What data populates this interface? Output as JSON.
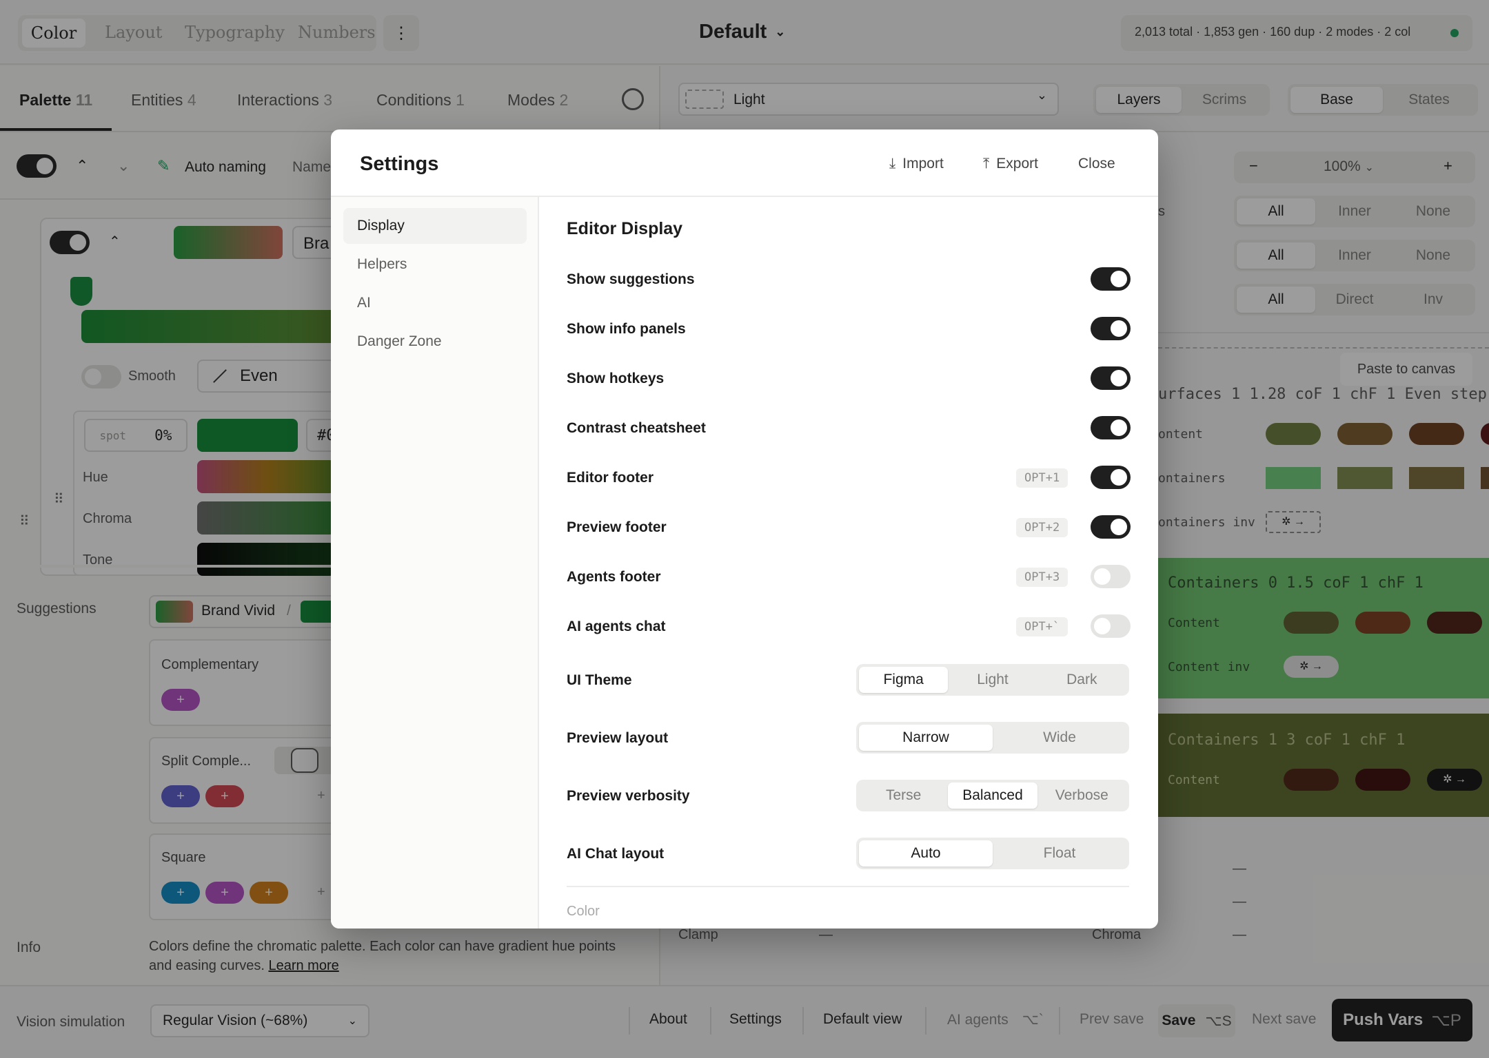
{
  "top_tabs": [
    "Color",
    "Layout",
    "Typography",
    "Numbers"
  ],
  "top_tabs_active": "Color",
  "mode_title": "Default",
  "stats_text": "2,013 total · 1,853 gen · 160 dup · 2 modes · 2 col",
  "stats_status_color": "#1aa05a",
  "left_tabs": [
    {
      "label": "Palette",
      "count": "11"
    },
    {
      "label": "Entities",
      "count": "4"
    },
    {
      "label": "Interactions",
      "count": "3"
    },
    {
      "label": "Conditions",
      "count": "1"
    },
    {
      "label": "Modes",
      "count": "2"
    }
  ],
  "toolbar": {
    "auto_naming": "Auto naming",
    "name_partial": "Name"
  },
  "color_row": {
    "name_partial": "Bra",
    "smooth": "Smooth",
    "easing": "Even",
    "spot_label": "spot",
    "spot_value": "0%",
    "hex_partial": "#0"
  },
  "sliders": [
    "Hue",
    "Chroma",
    "Tone"
  ],
  "suggestions": {
    "label": "Suggestions",
    "brand": "Brand Vivid",
    "separator": "/",
    "groups": [
      "Complementary",
      "Split Comple...",
      "Square"
    ]
  },
  "info": {
    "label": "Info",
    "text": "Colors define the chromatic palette. Each color can have gradient hue points and easing curves.",
    "link": "Learn more"
  },
  "vision": {
    "label": "Vision simulation",
    "value": "Regular Vision (~68%)"
  },
  "preview": {
    "mode_select": "Light",
    "layer_tabs": [
      "Layers",
      "Scrims"
    ],
    "layer_active": "Layers",
    "base_tabs": [
      "Base",
      "States"
    ],
    "base_active": "Base",
    "zoom": "100%",
    "zoom_minus": "−",
    "zoom_plus": "+",
    "filter_rows": [
      [
        "All",
        "Inner",
        "None"
      ],
      [
        "All",
        "Inner",
        "None"
      ],
      [
        "All",
        "Direct",
        "Inv"
      ]
    ],
    "filter_partial": "s",
    "paste": "Paste to canvas",
    "surfaces_header": "urfaces 1  1.28  coF  1  chF  1  Even  step",
    "rows1": [
      "ontent",
      "ontainers",
      "ontainers inv"
    ],
    "containers0_header": "Containers 0  1.5  coF  1  chF  1",
    "rows2": [
      "Content",
      "Content inv"
    ],
    "containers1_header": "Containers 1  3  coF  1  chF  1",
    "rows3": [
      "Content"
    ],
    "swatch_glyph": "✲ →",
    "dash": "—",
    "clamp": "Clamp",
    "chroma": "Chroma"
  },
  "bottom_bar": {
    "about": "About",
    "settings": "Settings",
    "default_view": "Default view",
    "ai_agents": "AI agents",
    "ai_agents_key": "⌥`",
    "prev_save": "Prev save",
    "save": "Save",
    "save_key": "⌥S",
    "next_save": "Next save",
    "push_vars": "Push Vars",
    "push_vars_key": "⌥P"
  },
  "modal": {
    "title": "Settings",
    "import": "Import",
    "export": "Export",
    "close": "Close",
    "nav": [
      "Display",
      "Helpers",
      "AI",
      "Danger Zone"
    ],
    "nav_active": "Display",
    "section_title": "Editor Display",
    "toggles": [
      {
        "label": "Show suggestions",
        "key": "",
        "on": true
      },
      {
        "label": "Show info panels",
        "key": "",
        "on": true
      },
      {
        "label": "Show hotkeys",
        "key": "",
        "on": true
      },
      {
        "label": "Contrast cheatsheet",
        "key": "",
        "on": true
      },
      {
        "label": "Editor footer",
        "key": "OPT+1",
        "on": true
      },
      {
        "label": "Preview footer",
        "key": "OPT+2",
        "on": true
      },
      {
        "label": "Agents footer",
        "key": "OPT+3",
        "on": false
      },
      {
        "label": "AI agents chat",
        "key": "OPT+`",
        "on": false
      }
    ],
    "selects": [
      {
        "label": "UI Theme",
        "options": [
          "Figma",
          "Light",
          "Dark"
        ],
        "selected": "Figma"
      },
      {
        "label": "Preview layout",
        "options": [
          "Narrow",
          "Wide"
        ],
        "selected": "Narrow"
      },
      {
        "label": "Preview verbosity",
        "options": [
          "Terse",
          "Balanced",
          "Verbose"
        ],
        "selected": "Balanced"
      },
      {
        "label": "AI Chat layout",
        "options": [
          "Auto",
          "Float"
        ],
        "selected": "Auto"
      }
    ],
    "next_section": "Color"
  }
}
